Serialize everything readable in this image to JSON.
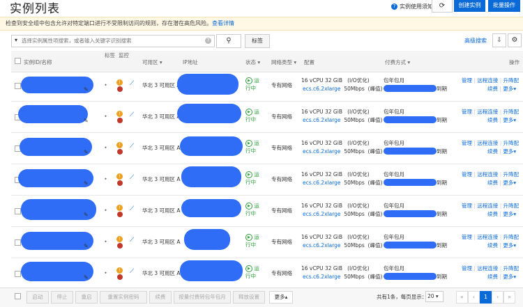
{
  "header": {
    "title": "实例列表",
    "help_link": "实例使用须知",
    "refresh_icon": "refresh-icon",
    "create_button": "创建实例",
    "batch_button": "批量操作"
  },
  "alert": {
    "text": "检查到安全组中包含允许对特定端口进行不受限制访问的规则，存在潜在高危风险。",
    "link": "查看详情"
  },
  "search": {
    "placeholder": "选择实例属性项搜索，或者输入关键字识别搜索",
    "tag_button": "标签",
    "advanced_search": "高级搜索"
  },
  "table": {
    "columns": {
      "id_name": "实例ID/名称",
      "tag": "标签",
      "monitor": "监控",
      "zone": "可用区",
      "ip": "IP地址",
      "status": "状态",
      "network": "网络类型",
      "config": "配置",
      "billing": "付费方式",
      "actions": "操作"
    },
    "rows": [
      {
        "zone": "华北 3 可用区 A",
        "status": "运行中",
        "network": "专有网络",
        "spec": "16 vCPU 32 GiB",
        "io": "(I/O优化)",
        "type": "ecs.c6.2xlarge",
        "bw": "50Mbps",
        "peak": "(峰值)",
        "billing": "包年包月",
        "expire": "到期",
        "a1": "管理",
        "a2": "远程连接",
        "a3": "升降配",
        "b1": "续费",
        "b2": "更多"
      },
      {
        "zone": "华北 3 可用区 A",
        "status": "运行中",
        "network": "专有网络",
        "spec": "16 vCPU 32 GiB",
        "io": "(I/O优化)",
        "type": "ecs.c6.2xlarge",
        "bw": "50Mbps",
        "peak": "(峰值)",
        "billing": "包年包月",
        "expire": "到期",
        "a1": "管理",
        "a2": "远程连接",
        "a3": "升降配",
        "b1": "续费",
        "b2": "更多"
      },
      {
        "zone": "华北 3 可用区 A",
        "status": "运行中",
        "network": "专有网络",
        "spec": "16 vCPU 32 GiB",
        "io": "(I/O优化)",
        "type": "ecs.c6.2xlarge",
        "bw": "50Mbps",
        "peak": "(峰值)",
        "billing": "包年包月",
        "expire": "到期",
        "a1": "管理",
        "a2": "远程连接",
        "a3": "升降配",
        "b1": "续费",
        "b2": "更多"
      },
      {
        "zone": "华北 3 可用区 A",
        "status": "运行中",
        "network": "专有网络",
        "spec": "16 vCPU 32 GiB",
        "io": "(I/O优化)",
        "type": "ecs.c6.2xlarge",
        "bw": "50Mbps",
        "peak": "(峰值)",
        "billing": "包年包月",
        "expire": "到期",
        "a1": "管理",
        "a2": "远程连接",
        "a3": "升降配",
        "b1": "续费",
        "b2": "更多"
      },
      {
        "zone": "华北 3 可用区 A",
        "status": "运行中",
        "network": "专有网络",
        "spec": "16 vCPU 32 GiB",
        "io": "(I/O优化)",
        "type": "ecs.c6.2xlarge",
        "bw": "50Mbps",
        "peak": "(峰值)",
        "billing": "包年包月",
        "expire": "到期",
        "a1": "管理",
        "a2": "远程连接",
        "a3": "升降配",
        "b1": "续费",
        "b2": "更多"
      },
      {
        "zone": "华北 3 可用区 A",
        "status": "运行中",
        "network": "专有网络",
        "spec": "16 vCPU 32 GiB",
        "io": "(I/O优化)",
        "type": "ecs.c6.2xlarge",
        "bw": "50Mbps",
        "peak": "(峰值)",
        "billing": "包年包月",
        "expire": "到期",
        "a1": "管理",
        "a2": "远程连接",
        "a3": "升降配",
        "b1": "续费",
        "b2": "更多"
      },
      {
        "zone": "华北 3 可用区 A",
        "status": "运行中",
        "network": "专有网络",
        "spec": "16 vCPU 32 GiB",
        "io": "(I/O优化)",
        "type": "ecs.c6.2xlarge",
        "bw": "50Mbps",
        "peak": "(峰值)",
        "billing": "包年包月",
        "expire": "到期",
        "a1": "管理",
        "a2": "远程连接",
        "a3": "升降配",
        "b1": "续费",
        "b2": "更多"
      }
    ]
  },
  "footer": {
    "buttons": [
      "启动",
      "停止",
      "重启",
      "重置实例密码",
      "续费",
      "按量付费转包年包月",
      "释放设置",
      "更多"
    ],
    "total": "共有1条，",
    "per_page_label": "每页显示：",
    "per_page": "20",
    "current_page": "1"
  },
  "colors": {
    "accent": "#0a6ad8",
    "running": "#2a9d37",
    "redaction": "#2f6df6"
  }
}
